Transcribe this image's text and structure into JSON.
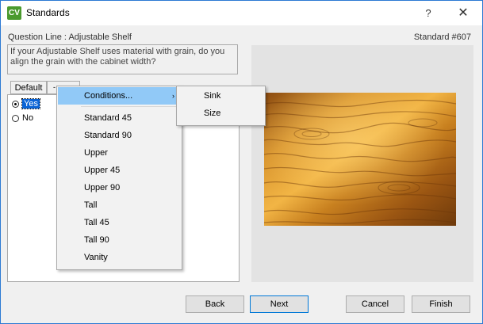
{
  "window": {
    "app_icon": "CV",
    "title": "Standards",
    "help_label": "?",
    "close_label": "✕"
  },
  "header": {
    "question_line": "Question Line : Adjustable Shelf",
    "standard_number": "Standard #607"
  },
  "question": {
    "text": "If your Adjustable Shelf uses material with grain, do you align the grain with the cabinet width?"
  },
  "tabs": {
    "default_label": "Default",
    "second_label": "-"
  },
  "options": [
    {
      "label": "Yes",
      "selected": true
    },
    {
      "label": "No",
      "selected": false
    }
  ],
  "context_menu": {
    "conditions_label": "Conditions...",
    "submenu_arrow": "›",
    "items": [
      "Standard 45",
      "Standard 90",
      "Upper",
      "Upper 45",
      "Upper 90",
      "Tall",
      "Tall 45",
      "Tall 90",
      "Vanity"
    ]
  },
  "submenu": {
    "items": [
      "Sink",
      "Size"
    ]
  },
  "buttons": {
    "back": "Back",
    "next": "Next",
    "cancel": "Cancel",
    "finish": "Finish"
  },
  "colors": {
    "accent": "#0078d7",
    "selection": "#0a64d6",
    "menu_highlight": "#91c9f7",
    "app_icon_bg": "#4a9a2e"
  }
}
